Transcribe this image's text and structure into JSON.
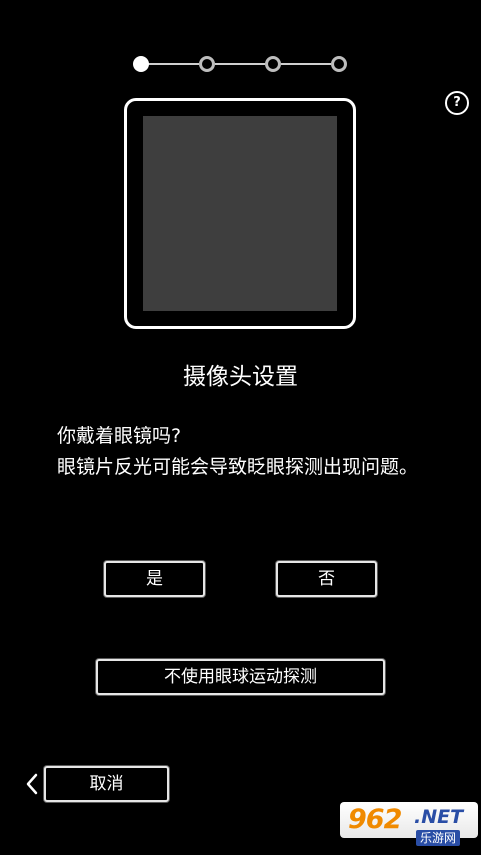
{
  "stepper": {
    "total_steps": 4,
    "current_step": 1
  },
  "help": {
    "label": "?"
  },
  "camera": {
    "preview_color": "#3e3e3e"
  },
  "title": "摄像头设置",
  "question": {
    "line1": "你戴着眼镜吗?",
    "line2": "眼镜片反光可能会导致眨眼探测出现问题。"
  },
  "buttons": {
    "yes": "是",
    "no": "否",
    "disable_eye_tracking": "不使用眼球运动探测",
    "cancel": "取消"
  },
  "back_icon": "chevron-left-icon",
  "watermark": {
    "number": "962",
    "suffix": ".NET",
    "site_name": "乐游网"
  }
}
